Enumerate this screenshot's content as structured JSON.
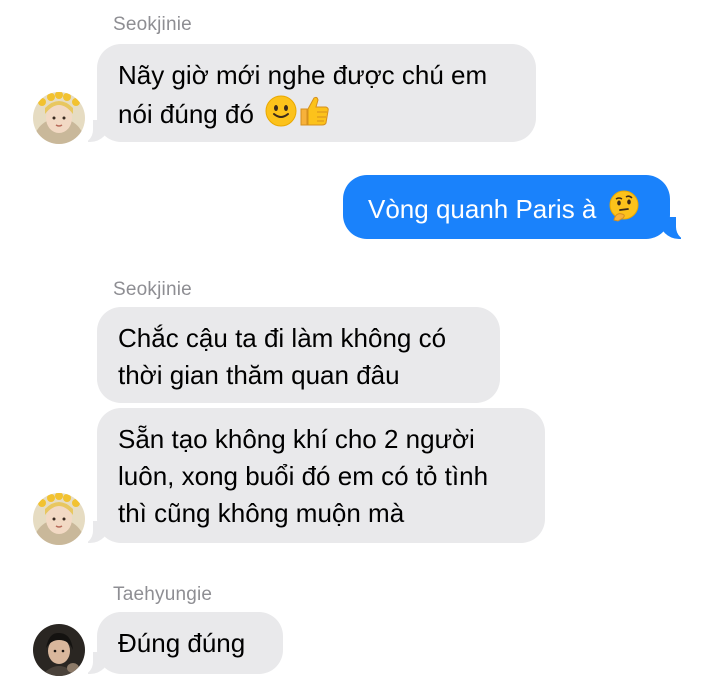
{
  "messages": [
    {
      "sender": "Seokjinie",
      "direction": "incoming",
      "lines": [
        "Nãy giờ mới nghe được chú em",
        "nói đúng đó"
      ],
      "emojis": [
        "slightly-smiling-face",
        "thumbs-up"
      ]
    },
    {
      "direction": "outgoing",
      "text": "Vòng quanh Paris à",
      "emoji": "thinking-face"
    },
    {
      "sender": "Seokjinie",
      "direction": "incoming",
      "lines": [
        "Chắc cậu ta đi làm không có",
        "thời gian thăm quan đâu"
      ]
    },
    {
      "direction": "incoming",
      "lines": [
        "Sẵn tạo không khí cho 2 người",
        "luôn, xong buổi đó em có tỏ tình",
        "thì cũng không muộn mà"
      ]
    },
    {
      "sender": "Taehyungie",
      "direction": "incoming",
      "lines": [
        "Đúng đúng"
      ]
    }
  ],
  "colors": {
    "incoming_bubble": "#e9e9eb",
    "outgoing_bubble": "#1a82fb",
    "sender_label": "#8e8e93"
  }
}
